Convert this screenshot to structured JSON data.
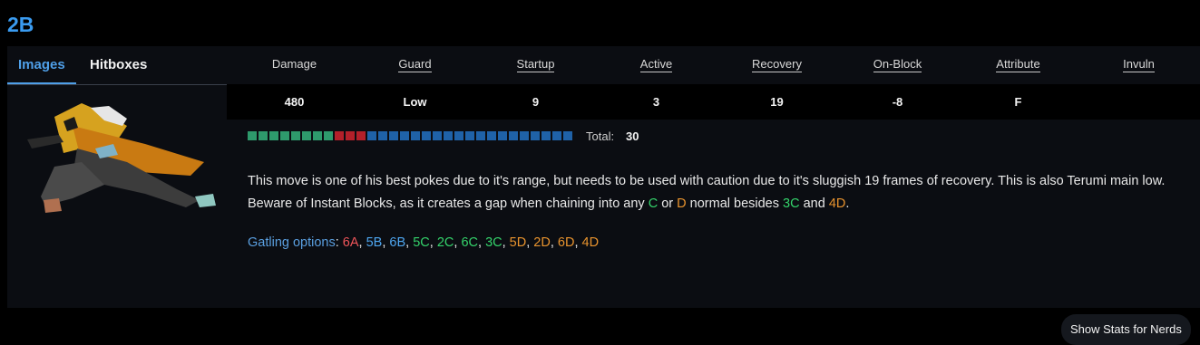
{
  "move": {
    "name": "2B"
  },
  "tabs": {
    "images": "Images",
    "hitboxes": "Hitboxes"
  },
  "stats": {
    "headers": [
      "Damage",
      "Guard",
      "Startup",
      "Active",
      "Recovery",
      "On-Block",
      "Attribute",
      "Invuln"
    ],
    "values": [
      "480",
      "Low",
      "9",
      "3",
      "19",
      "-8",
      "F",
      ""
    ]
  },
  "frame_data": {
    "startup_frames": 9,
    "active_frames": 3,
    "recovery_frames": 19,
    "total_label": "Total:",
    "total_value": "30",
    "colors": {
      "startup": "#2e9a6c",
      "active": "#b3202a",
      "recovery": "#1f62a8"
    }
  },
  "description": {
    "part1": "This move is one of his best pokes due to it's range, but needs to be used with caution due to it's sluggish 19 frames of recovery. This is also Terumi main low. Beware of Instant Blocks, as it creates a gap when chaining into any ",
    "c": "C",
    "or": " or ",
    "d": "D",
    "part2": " normal besides ",
    "n3c": "3C",
    "and": " and ",
    "n4d": "4D",
    "end": "."
  },
  "gatling": {
    "label": "Gatling options",
    "colon": ": ",
    "options": [
      {
        "text": "6A",
        "color": "#f0555a"
      },
      {
        "text": "5B",
        "color": "#4ea6f0"
      },
      {
        "text": "6B",
        "color": "#4ea6f0"
      },
      {
        "text": "5C",
        "color": "#34d36b"
      },
      {
        "text": "2C",
        "color": "#34d36b"
      },
      {
        "text": "6C",
        "color": "#34d36b"
      },
      {
        "text": "3C",
        "color": "#34d36b"
      },
      {
        "text": "5D",
        "color": "#e8932e"
      },
      {
        "text": "2D",
        "color": "#e8932e"
      },
      {
        "text": "6D",
        "color": "#e8932e"
      },
      {
        "text": "4D",
        "color": "#e8932e"
      }
    ]
  },
  "buttons": {
    "nerds": "Show Stats for Nerds"
  }
}
